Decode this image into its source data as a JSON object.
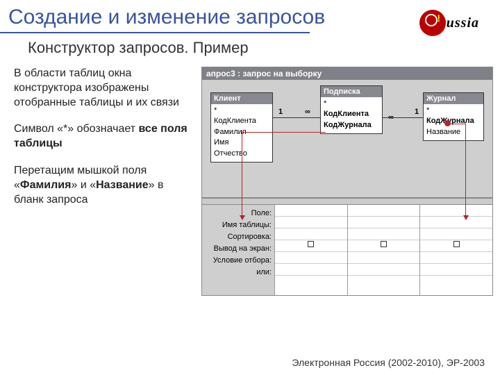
{
  "title": "Создание и изменение запросов",
  "subtitle": "Конструктор запросов. Пример",
  "logo_text": "russia",
  "left": {
    "p1": "В области таблиц окна конструктора изображены отобранные таблицы и их связи",
    "p2_a": "Символ «*» обозначает ",
    "p2_b": "все поля таблицы",
    "p3_a": "Перетащим мышкой  поля «",
    "p3_b": "Фамилия",
    "p3_c": "» и «",
    "p3_d": "Название",
    "p3_e": "» в бланк запроса"
  },
  "window": {
    "title": "апрос3 : запрос на выборку",
    "tables": {
      "t1": {
        "name": "Клиент",
        "fields": [
          "*",
          "КодКлиента",
          "Фамилия",
          "Имя",
          "Отчество"
        ]
      },
      "t2": {
        "name": "Подписка",
        "fields": [
          "*",
          "КодКлиента",
          "КодЖурнала"
        ]
      },
      "t3": {
        "name": "Журнал",
        "fields": [
          "*",
          "КодЖурнала",
          "Название"
        ]
      }
    },
    "relations": {
      "one": "1",
      "many": "∞"
    },
    "grid_labels": [
      "Поле:",
      "Имя таблицы:",
      "Сортировка:",
      "Вывод на экран:",
      "Условие отбора:",
      "или:"
    ]
  },
  "footer": "Электронная Россия (2002-2010), ЭР-2003"
}
